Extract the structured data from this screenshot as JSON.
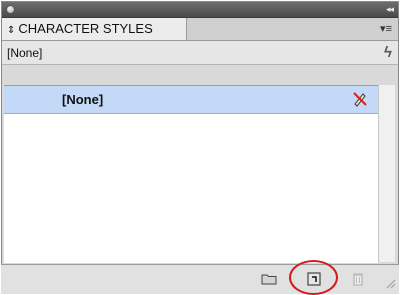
{
  "titlebar": {
    "collapse_icon": "double-chevron-icon",
    "collapse_glyph": "◂◂"
  },
  "tab": {
    "arrows": "⇕",
    "label": "CHARACTER STYLES"
  },
  "panel_menu": {
    "icon": "panel-menu-icon",
    "glyph": "▾≡"
  },
  "current_style": {
    "label": "[None]",
    "icon": "lightning-icon",
    "glyph": "ϟ"
  },
  "list": {
    "items": [
      {
        "label": "[None]",
        "icon": "no-edit-pencil-icon"
      }
    ]
  },
  "bottom_toolbar": {
    "buttons": [
      {
        "name": "new-group-button",
        "icon": "folder-icon"
      },
      {
        "name": "create-new-style-button",
        "icon": "new-page-icon"
      },
      {
        "name": "delete-style-button",
        "icon": "trash-icon"
      }
    ]
  },
  "annotation": {
    "color": "#d31b1b"
  }
}
